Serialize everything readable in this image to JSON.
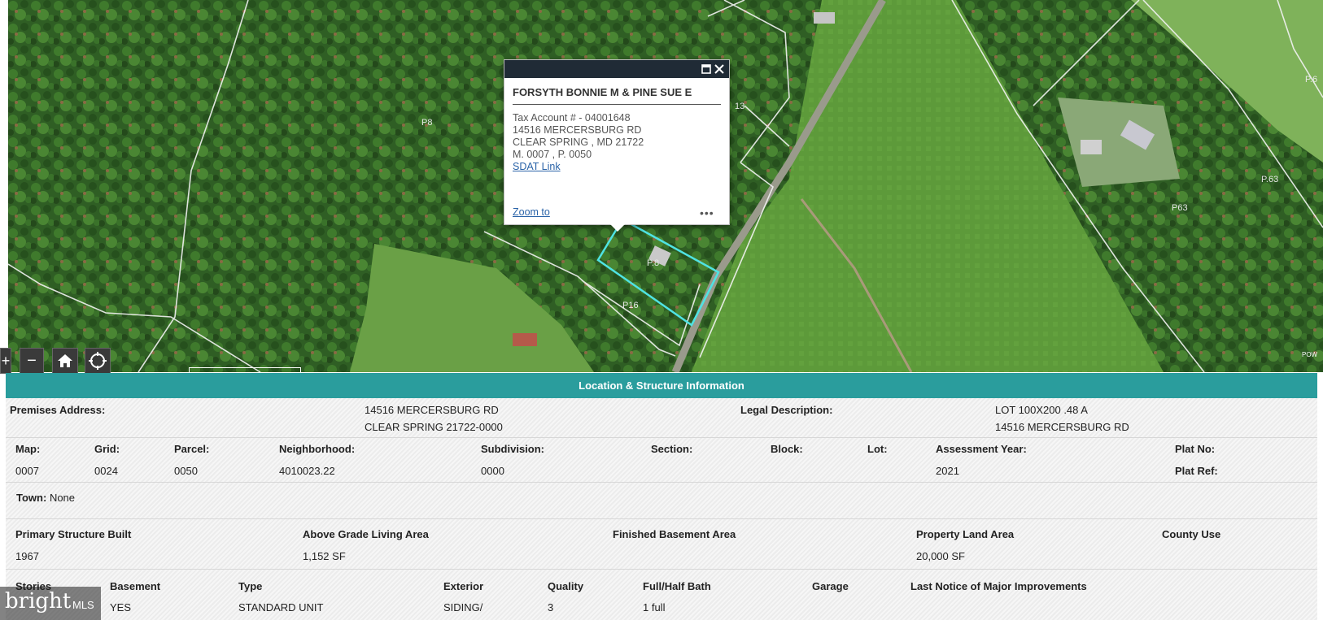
{
  "map": {
    "parcel_labels": [
      {
        "text": "P8"
      },
      {
        "text": "P16"
      },
      {
        "text": "P63"
      },
      {
        "text": "P.63"
      },
      {
        "text": "P.6"
      },
      {
        "text": "P.8"
      },
      {
        "text": "13"
      }
    ],
    "controls": {
      "zoom_in": "+",
      "zoom_out": "−"
    },
    "attribution": "POW"
  },
  "popup": {
    "owner": "FORSYTH BONNIE M & PINE SUE E",
    "lines": [
      "Tax Account # - 04001648",
      "14516 MERCERSBURG RD",
      "CLEAR SPRING , MD  21722",
      "M. 0007 , P. 0050"
    ],
    "sdat_link": "SDAT Link",
    "zoom_to": "Zoom to",
    "more": "•••",
    "maximize_icon": "maximize-icon",
    "close_icon": "close-icon"
  },
  "section": {
    "title": "Location & Structure Information"
  },
  "premises": {
    "label": "Premises Address:",
    "line1": "14516 MERCERSBURG RD",
    "line2": "CLEAR SPRING 21722-0000",
    "legal_label": "Legal Description:",
    "legal1": "LOT 100X200 .48 A",
    "legal2": "14516 MERCERSBURG RD"
  },
  "row1": {
    "headers": [
      "Map:",
      "Grid:",
      "Parcel:",
      "Neighborhood:",
      "Subdivision:",
      "Section:",
      "Block:",
      "Lot:",
      "Assessment Year:",
      "Plat No:"
    ],
    "values": [
      "0007",
      "0024",
      "0050",
      "4010023.22",
      "0000",
      "",
      "",
      "",
      "2021"
    ],
    "plat_ref": "Plat Ref:"
  },
  "town": {
    "label": "Town:",
    "value": "None"
  },
  "structure": {
    "headers": [
      "Primary Structure Built",
      "Above Grade Living Area",
      "Finished Basement Area",
      "Property Land Area",
      "County Use"
    ],
    "values": [
      "1967",
      "1,152 SF",
      "",
      "20,000 SF",
      ""
    ]
  },
  "details": {
    "headers": [
      "Stories",
      "Basement",
      "Type",
      "Exterior",
      "Quality",
      "Full/Half Bath",
      "Garage",
      "Last Notice of Major Improvements"
    ],
    "values": [
      "",
      "YES",
      "STANDARD UNIT",
      "SIDING/",
      "3",
      "1 full",
      "",
      ""
    ]
  },
  "watermark": {
    "brand": "bright",
    "suffix": "MLS"
  },
  "colors": {
    "teal": "#2a9d9d",
    "highlight_parcel": "#4fe3e3",
    "popup_header": "#202b36"
  }
}
